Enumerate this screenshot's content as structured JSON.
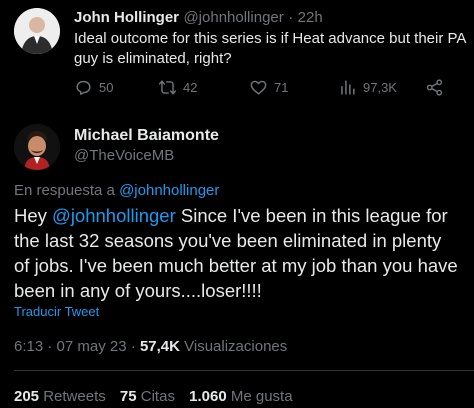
{
  "reply": {
    "name": "John Hollinger",
    "handle": "@johnhollinger",
    "sep": "·",
    "time": "22h",
    "text_line1": "Ideal outcome for this series is if Heat advance but their PA",
    "text_line2": "guy is eliminated, right?",
    "actions": {
      "replies": "50",
      "retweets": "42",
      "likes": "71",
      "views": "97,3K"
    }
  },
  "tweet": {
    "name": "Michael Baiamonte",
    "handle": "@TheVoiceMB",
    "reply_prefix": "En respuesta a",
    "reply_to": "@johnhollinger",
    "line1_start": "Hey",
    "line1_mention": "@johnhollinger",
    "line1_rest": "Since I've been in this league for",
    "line2": "the last 32 seasons you've been eliminated in plenty",
    "line3": "of jobs. I've been much better at my job than you have",
    "line4": "been in any of yours....loser!!!!",
    "translate": "Traducir Tweet",
    "time": "6:13",
    "dot": "·",
    "date": "07 may 23",
    "views_count": "57,4K",
    "views_label": "Visualizaciones"
  },
  "stats": {
    "retweets_count": "205",
    "retweets_label": "Retweets",
    "quotes_count": "75",
    "quotes_label": "Citas",
    "likes_count": "1.060",
    "likes_label": "Me gusta"
  },
  "colors": {
    "background": "#000000",
    "text": "#e7e9ea",
    "muted": "#71767b",
    "accent": "#1d9bf0"
  },
  "icons": [
    "reply-icon",
    "retweet-icon",
    "like-icon",
    "views-icon",
    "share-icon"
  ]
}
